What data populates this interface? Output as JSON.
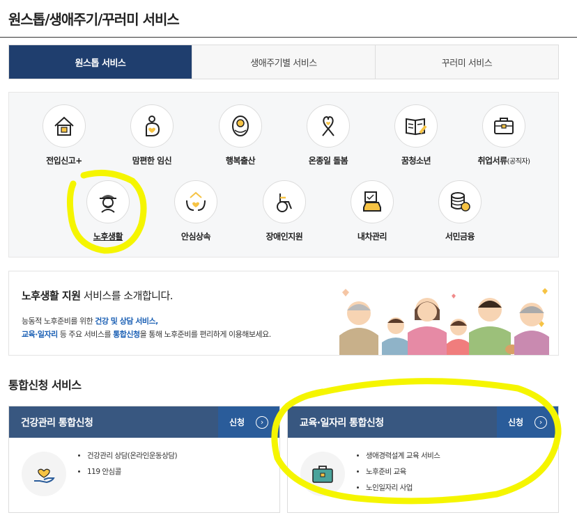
{
  "page": {
    "title": "원스톱/생애주기/꾸러미 서비스"
  },
  "tabs": [
    {
      "label": "원스톱 서비스",
      "active": true
    },
    {
      "label": "생애주기별 서비스",
      "active": false
    },
    {
      "label": "꾸러미 서비스",
      "active": false
    }
  ],
  "services": [
    {
      "label": "전입신고+",
      "icon": "house-icon"
    },
    {
      "label": "맘편한 임신",
      "icon": "pregnancy-icon"
    },
    {
      "label": "행복출산",
      "icon": "baby-icon"
    },
    {
      "label": "온종일 돌봄",
      "icon": "ribbon-heart-icon"
    },
    {
      "label": "꿈청소년",
      "icon": "book-icon"
    },
    {
      "label": "취업서류",
      "label_small": "(공직자)",
      "icon": "briefcase-icon"
    },
    {
      "label": "노후생활",
      "icon": "elder-icon",
      "selected": true
    },
    {
      "label": "안심상속",
      "icon": "hands-house-icon"
    },
    {
      "label": "장애인지원",
      "icon": "wheelchair-icon"
    },
    {
      "label": "내차관리",
      "icon": "car-icon"
    },
    {
      "label": "서민금융",
      "icon": "coins-icon"
    }
  ],
  "intro": {
    "heading_strong": "노후생활 지원",
    "heading_rest": " 서비스를 소개합니다.",
    "line1_prefix": "능동적 노후준비를 위한 ",
    "line1_hl": "건강 및 상담 서비스,",
    "line2_hl1": "교육·일자리",
    "line2_mid1": " 등 주요 서비스를 ",
    "line2_hl2": "통합신청",
    "line2_rest": "을 통해 노후준비를 편리하게 이용해보세요."
  },
  "integrated": {
    "section_title": "통합신청 서비스",
    "cards": [
      {
        "title": "건강관리 통합신청",
        "apply_label": "신청",
        "icon": "hand-heart-icon",
        "items": [
          "건강관리 상담(온라인운동상담)",
          "119 안심콜"
        ]
      },
      {
        "title": "교육·일자리 통합신청",
        "apply_label": "신청",
        "icon": "briefcase-green-icon",
        "items": [
          "생애경력설계 교육 서비스",
          "노후준비 교육",
          "노인일자리 사업"
        ]
      }
    ]
  },
  "colors": {
    "tab_active": "#1f3e6e",
    "card_header": "#385780",
    "apply_button": "#2a5c9a",
    "highlight_text": "#1a5fb4",
    "annotation_yellow": "#f5f500",
    "icon_yellow": "#f6c344"
  }
}
